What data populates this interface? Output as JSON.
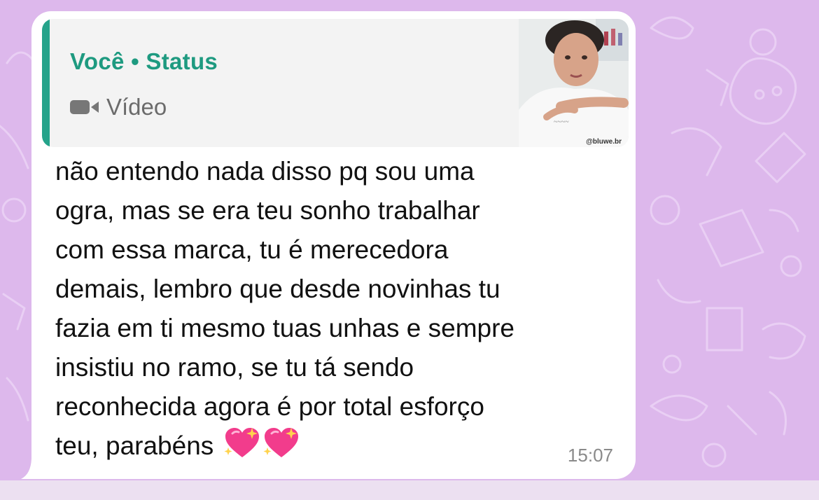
{
  "quote": {
    "title": "Você • Status",
    "type_label": "Vídeo",
    "thumbnail_watermark": "@bluwe.br",
    "icon": "video-camera-icon"
  },
  "message": {
    "text": "não entendo nada disso pq sou uma\nogra, mas se era teu sonho trabalhar\ncom essa marca, tu é merecedora\ndemais, lembro que desde novinhas tu\nfazia em ti mesmo tuas unhas e sempre\ninsistiu no ramo, se tu tá sendo\nreconhecida agora é por total esforço\nteu, parabéns",
    "emoji": [
      "sparkling-heart",
      "sparkling-heart"
    ],
    "time": "15:07"
  },
  "colors": {
    "background": "#ddb8ec",
    "bubble": "#ffffff",
    "quote_accent": "#25a38a",
    "quote_title": "#1e9a80"
  }
}
